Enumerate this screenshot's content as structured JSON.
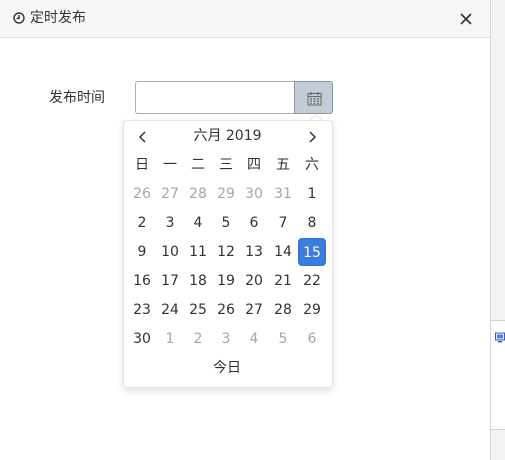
{
  "dialog": {
    "title": "定时发布",
    "title_icon": "clock-icon",
    "close_icon": "close-icon"
  },
  "form": {
    "label": "发布时间",
    "date_value": "",
    "calendar_icon": "calendar-icon"
  },
  "picker": {
    "month_title": "六月 2019",
    "prev_icon": "chevron-left-icon",
    "next_icon": "chevron-right-icon",
    "weekdays": [
      "日",
      "一",
      "二",
      "三",
      "四",
      "五",
      "六"
    ],
    "weeks": [
      [
        {
          "d": "26",
          "muted": true
        },
        {
          "d": "27",
          "muted": true
        },
        {
          "d": "28",
          "muted": true
        },
        {
          "d": "29",
          "muted": true
        },
        {
          "d": "30",
          "muted": true
        },
        {
          "d": "31",
          "muted": true
        },
        {
          "d": "1"
        }
      ],
      [
        {
          "d": "2"
        },
        {
          "d": "3"
        },
        {
          "d": "4"
        },
        {
          "d": "5"
        },
        {
          "d": "6"
        },
        {
          "d": "7"
        },
        {
          "d": "8"
        }
      ],
      [
        {
          "d": "9"
        },
        {
          "d": "10"
        },
        {
          "d": "11"
        },
        {
          "d": "12"
        },
        {
          "d": "13"
        },
        {
          "d": "14"
        },
        {
          "d": "15",
          "selected": true
        }
      ],
      [
        {
          "d": "16"
        },
        {
          "d": "17"
        },
        {
          "d": "18"
        },
        {
          "d": "19"
        },
        {
          "d": "20"
        },
        {
          "d": "21"
        },
        {
          "d": "22"
        }
      ],
      [
        {
          "d": "23"
        },
        {
          "d": "24"
        },
        {
          "d": "25"
        },
        {
          "d": "26"
        },
        {
          "d": "27"
        },
        {
          "d": "28"
        },
        {
          "d": "29"
        }
      ],
      [
        {
          "d": "30"
        },
        {
          "d": "1",
          "muted": true
        },
        {
          "d": "2",
          "muted": true
        },
        {
          "d": "3",
          "muted": true
        },
        {
          "d": "4",
          "muted": true
        },
        {
          "d": "5",
          "muted": true
        },
        {
          "d": "6",
          "muted": true
        }
      ]
    ],
    "today_label": "今日"
  },
  "background": {
    "monitor_icon": "monitor-icon"
  },
  "colors": {
    "selected_day": "#3b7ddd",
    "muted_day": "#a6a6a6",
    "calendar_button": "#c4ccd7"
  }
}
